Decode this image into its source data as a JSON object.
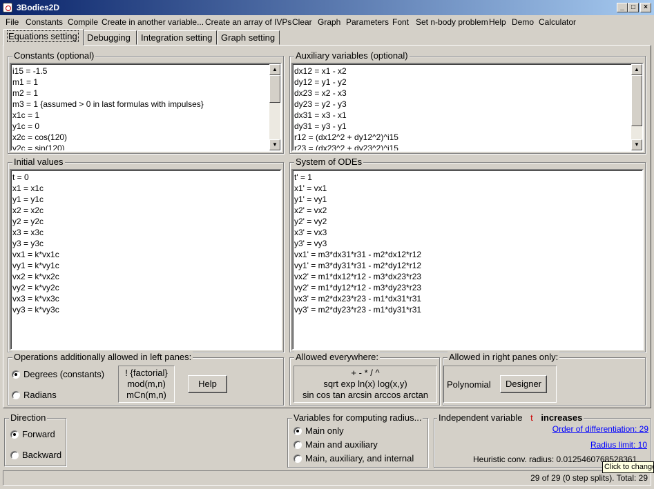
{
  "window": {
    "title": "3Bodies2D",
    "controls": [
      "_",
      "□",
      "×"
    ]
  },
  "menu": [
    "File",
    "Constants",
    "Compile",
    "Create in another variable...",
    "Create an array of IVPs",
    "Clear",
    "Graph",
    "Parameters",
    "Font",
    "Set n-body problem",
    "Help",
    "Demo",
    "Calculator"
  ],
  "tabs": [
    "Equations setting",
    "Debugging",
    "Integration setting",
    "Graph setting"
  ],
  "constants": {
    "title": "Constants (optional)",
    "lines": [
      "i15 = -1.5",
      "m1 = 1",
      "m2 = 1",
      "m3 = 1  {assumed > 0 in last formulas with impulses}",
      "x1c = 1",
      "y1c = 0",
      "x2c = cos(120)",
      "y2c = sin(120)"
    ]
  },
  "auxiliary": {
    "title": "Auxiliary variables (optional)",
    "lines": [
      "dx12 = x1 - x2",
      "dy12 = y1 - y2",
      "dx23 = x2 - x3",
      "dy23 = y2 - y3",
      "dx31 = x3 - x1",
      "dy31 = y3 - y1",
      "r12 = (dx12^2 + dy12^2)^i15",
      "r23 = (dx23^2 + dy23^2)^i15"
    ]
  },
  "initial": {
    "title": "Initial values",
    "lines": [
      "t = 0",
      "x1 = x1c",
      "y1 = y1c",
      "x2 = x2c",
      "y2 = y2c",
      "x3 = x3c",
      "y3 = y3c",
      "vx1 = k*vx1c",
      "vy1 = k*vy1c",
      "vx2 = k*vx2c",
      "vy2 = k*vy2c",
      "vx3 = k*vx3c",
      "vy3 = k*vy3c"
    ]
  },
  "odes": {
    "title": "System of ODEs",
    "lines": [
      "t' = 1",
      "x1' = vx1",
      "y1' = vy1",
      "x2' = vx2",
      "y2' = vy2",
      "x3' = vx3",
      "y3' = vy3",
      "vx1' = m3*dx31*r31 - m2*dx12*r12",
      "vy1' = m3*dy31*r31 - m2*dy12*r12",
      "vx2' = m1*dx12*r12 - m3*dx23*r23",
      "vy2' = m1*dy12*r12 - m3*dy23*r23",
      "vx3' = m2*dx23*r23 - m1*dx31*r31",
      "vy3' = m2*dy23*r23 - m1*dy31*r31"
    ]
  },
  "ops_left": {
    "title": "Operations additionally allowed in left panes:",
    "degrees": "Degrees (constants)",
    "radians": "Radians",
    "funcs": [
      "! {factorial}",
      "mod(m,n)",
      "mCn(m,n)"
    ],
    "help": "Help"
  },
  "allowed_everywhere": {
    "title": "Allowed everywhere:",
    "row1": "+   -   *   /   ^",
    "row2": "sqrt  exp  ln(x)  log(x,y)",
    "row3": "sin  cos  tan arcsin  arccos  arctan"
  },
  "allowed_right": {
    "title": "Allowed in right panes only:",
    "polynomial": "Polynomial",
    "designer": "Designer"
  },
  "direction": {
    "title": "Direction",
    "forward": "Forward",
    "backward": "Backward",
    "selected": "Forward"
  },
  "radius_vars": {
    "title": "Variables for computing radius...",
    "main_only": "Main only",
    "main_aux": "Main and auxiliary",
    "main_aux_int": "Main, auxiliary, and internal",
    "selected": "Main only"
  },
  "independent": {
    "title": "Independent variable",
    "var": "t",
    "state": "increases",
    "order": "Order of differentiation: 29",
    "radius_limit": "Radius limit: 10",
    "heuristic": "Heuristic conv. radius: 0.0125460768528361",
    "tooltip": "Click to change"
  },
  "status": "29 of 29  (0 step splits). Total: 29",
  "colors": {
    "titlebar_start": "#0a246a",
    "titlebar_end": "#a6caf0",
    "link": "#0000ff",
    "indep_var": "#cc0000"
  }
}
